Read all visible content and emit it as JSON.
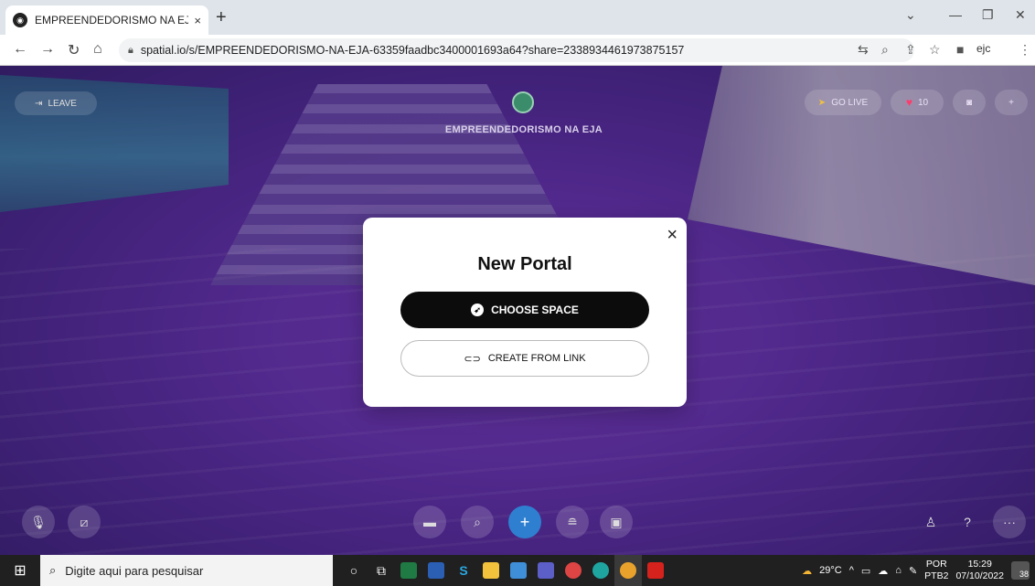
{
  "browser": {
    "tab_title": "EMPREENDEDORISMO NA EJA | ",
    "tab_close": "×",
    "new_tab": "+",
    "url": "spatial.io/s/EMPREENDEDORISMO-NA-EJA-63359faadbc3400001693a64?share=2338934461973875157",
    "ext_label": "ejc"
  },
  "scene": {
    "leave_label": "LEAVE",
    "space_name": "EMPREENDEDORISMO NA EJA",
    "go_live_label": "GO LIVE",
    "likes_count": "10"
  },
  "modal": {
    "title": "New Portal",
    "close": "×",
    "choose_space_label": "CHOOSE SPACE",
    "create_from_link_label": "CREATE FROM LINK"
  },
  "taskbar": {
    "search_placeholder": "Digite aqui para pesquisar",
    "temperature": "29°C",
    "lang_top": "POR",
    "lang_bottom": "PTB2",
    "time": "15:29",
    "date": "07/10/2022",
    "notifications": "38"
  },
  "colors": {
    "scene_purple": "#6a35b5",
    "accent_blue": "#2f7fd0",
    "primary_button": "#0c0c0c",
    "heart": "#ff3b6b"
  }
}
